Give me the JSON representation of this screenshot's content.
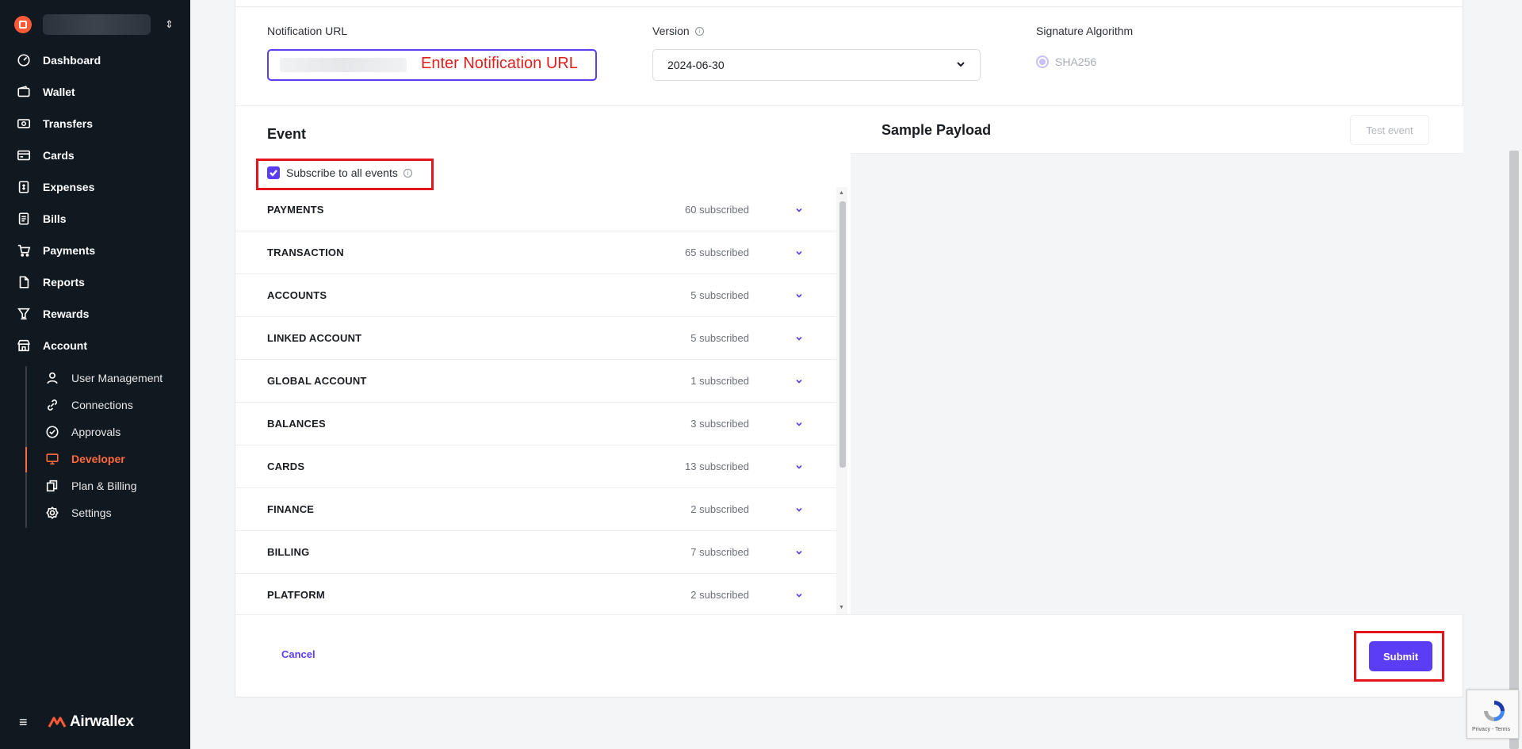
{
  "sidebar": {
    "nav": [
      {
        "label": "Dashboard",
        "icon": "dashboard-icon"
      },
      {
        "label": "Wallet",
        "icon": "wallet-icon"
      },
      {
        "label": "Transfers",
        "icon": "transfers-icon"
      },
      {
        "label": "Cards",
        "icon": "card-icon"
      },
      {
        "label": "Expenses",
        "icon": "expenses-icon"
      },
      {
        "label": "Bills",
        "icon": "bills-icon"
      },
      {
        "label": "Payments",
        "icon": "cart-icon"
      },
      {
        "label": "Reports",
        "icon": "reports-icon"
      },
      {
        "label": "Rewards",
        "icon": "trophy-icon"
      },
      {
        "label": "Account",
        "icon": "account-icon"
      }
    ],
    "sub": [
      {
        "label": "User Management",
        "icon": "user-icon"
      },
      {
        "label": "Connections",
        "icon": "link-icon"
      },
      {
        "label": "Approvals",
        "icon": "check-circle-icon"
      },
      {
        "label": "Developer",
        "icon": "monitor-icon"
      },
      {
        "label": "Plan & Billing",
        "icon": "copy-icon"
      },
      {
        "label": "Settings",
        "icon": "gear-icon"
      }
    ],
    "active_sub": "Developer",
    "brand": "Airwallex"
  },
  "form": {
    "notification_url_label": "Notification URL",
    "version_label": "Version",
    "version_value": "2024-06-30",
    "signature_label": "Signature Algorithm",
    "signature_value": "SHA256"
  },
  "annotation": {
    "url_hint": "Enter Notification URL"
  },
  "event": {
    "title": "Event",
    "subscribe_all_label": "Subscribe to all events",
    "subscribe_all_checked": true,
    "rows": [
      {
        "name": "PAYMENTS",
        "count": "60 subscribed"
      },
      {
        "name": "TRANSACTION",
        "count": "65 subscribed"
      },
      {
        "name": "ACCOUNTS",
        "count": "5 subscribed"
      },
      {
        "name": "LINKED ACCOUNT",
        "count": "5 subscribed"
      },
      {
        "name": "GLOBAL ACCOUNT",
        "count": "1 subscribed"
      },
      {
        "name": "BALANCES",
        "count": "3 subscribed"
      },
      {
        "name": "CARDS",
        "count": "13 subscribed"
      },
      {
        "name": "FINANCE",
        "count": "2 subscribed"
      },
      {
        "name": "BILLING",
        "count": "7 subscribed"
      },
      {
        "name": "PLATFORM",
        "count": "2 subscribed"
      }
    ]
  },
  "payload": {
    "title": "Sample Payload",
    "test_button": "Test event"
  },
  "footer": {
    "cancel": "Cancel",
    "submit": "Submit"
  },
  "recaptcha": {
    "text": "Privacy - Terms"
  },
  "colors": {
    "accent": "#5b3df5",
    "brand": "#ff5a36",
    "sidebar_bg": "#101820",
    "annotation_red": "#e3141b"
  }
}
